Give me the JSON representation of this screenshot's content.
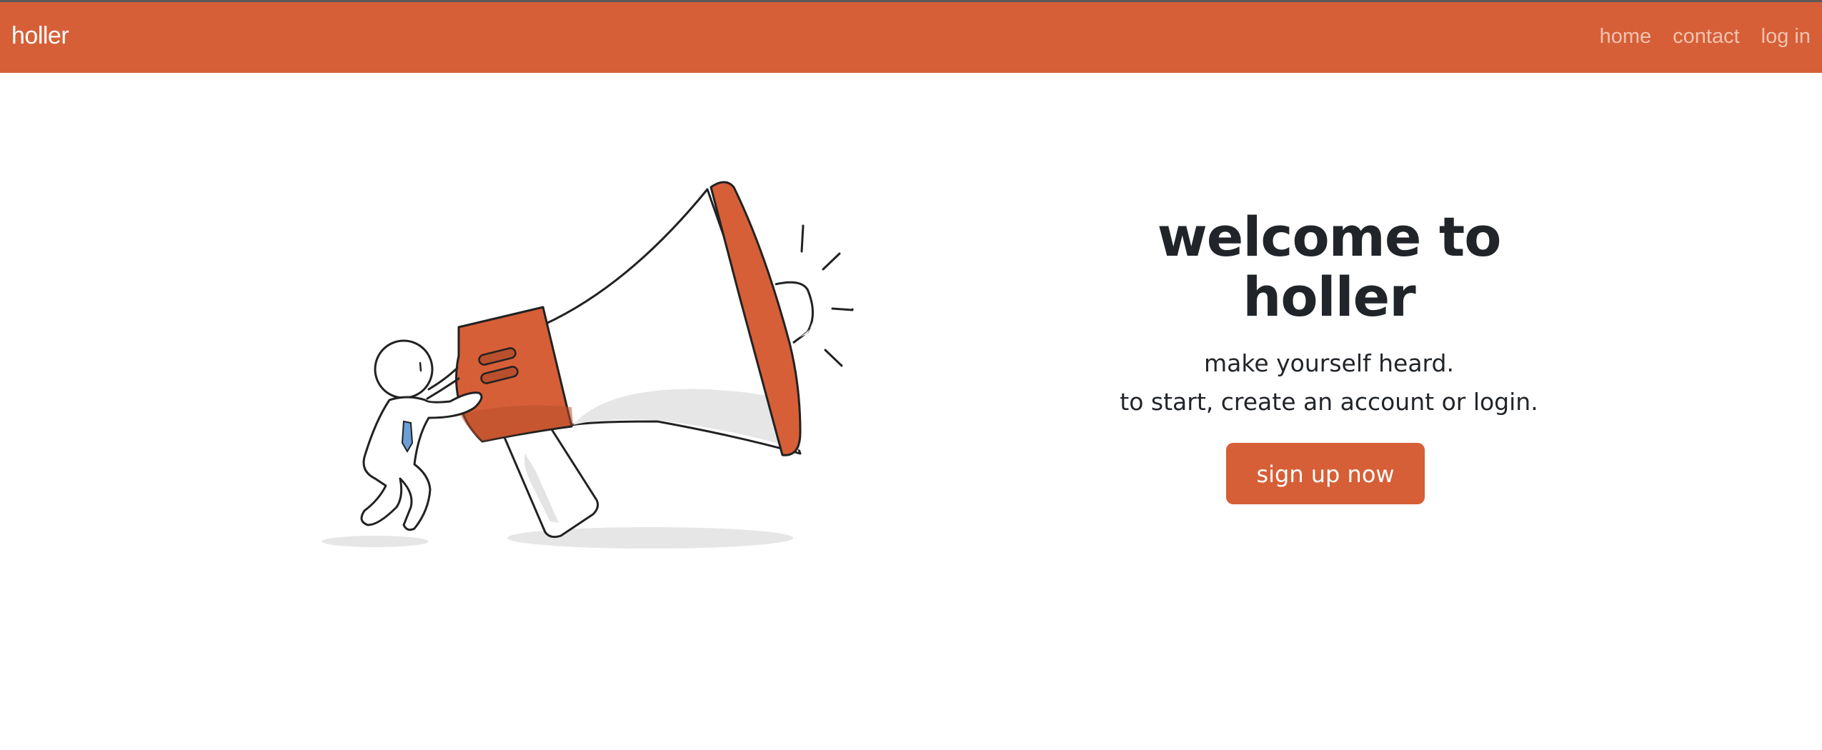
{
  "navbar": {
    "brand": "holler",
    "links": [
      {
        "label": "home"
      },
      {
        "label": "contact"
      },
      {
        "label": "log in"
      }
    ]
  },
  "hero": {
    "title_line1": "welcome to",
    "title_line2": "holler",
    "subtitle_line1": "make yourself heard.",
    "subtitle_line2": "to start, create an account or login.",
    "cta_label": "sign up now"
  },
  "illustration": {
    "icon": "megaphone-person-illustration"
  },
  "colors": {
    "brand": "#d65f37",
    "nav_link": "#f3c3b1",
    "heading": "#212529"
  }
}
